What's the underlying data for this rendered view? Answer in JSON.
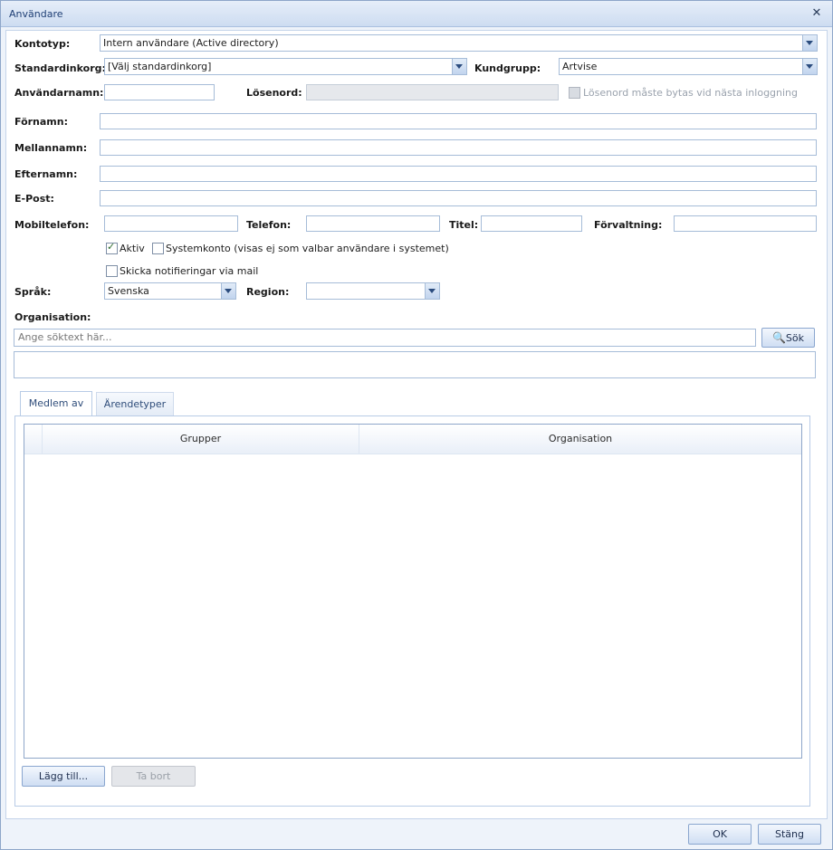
{
  "window": {
    "title": "Användare"
  },
  "form": {
    "kontotyp": {
      "label": "Kontotyp:",
      "value": "Intern användare (Active directory)"
    },
    "standardinkorg": {
      "label": "Standardinkorg:",
      "value": "[Välj standardinkorg]"
    },
    "kundgrupp": {
      "label": "Kundgrupp:",
      "value": "Artvise"
    },
    "anvandarnamn": {
      "label": "Användarnamn:",
      "value": ""
    },
    "losenord": {
      "label": "Lösenord:",
      "value": ""
    },
    "losenord_change": {
      "label": "Lösenord måste bytas vid nästa inloggning",
      "checked": false
    },
    "fornamn": {
      "label": "Förnamn:",
      "value": ""
    },
    "mellannamn": {
      "label": "Mellannamn:",
      "value": ""
    },
    "efternamn": {
      "label": "Efternamn:",
      "value": ""
    },
    "epost": {
      "label": "E-Post:",
      "value": ""
    },
    "mobiltelefon": {
      "label": "Mobiltelefon:",
      "value": ""
    },
    "telefon": {
      "label": "Telefon:",
      "value": ""
    },
    "titel": {
      "label": "Titel:",
      "value": ""
    },
    "forvaltning": {
      "label": "Förvaltning:",
      "value": ""
    },
    "aktiv": {
      "label": "Aktiv",
      "checked": true
    },
    "systemkonto": {
      "label": "Systemkonto (visas ej som valbar användare i systemet)",
      "checked": false
    },
    "notifieringar": {
      "label": "Skicka notifieringar via mail",
      "checked": false
    },
    "sprak": {
      "label": "Språk:",
      "value": "Svenska"
    },
    "region": {
      "label": "Region:",
      "value": ""
    },
    "organisation": {
      "label": "Organisation:",
      "search_placeholder": "Ange söktext här...",
      "search_button": "Sök"
    }
  },
  "tabs": [
    {
      "label": "Medlem av",
      "active": true
    },
    {
      "label": "Ärendetyper",
      "active": false
    }
  ],
  "grid": {
    "columns": [
      "Grupper",
      "Organisation"
    ],
    "rows": []
  },
  "panel_buttons": {
    "add": "Lägg till...",
    "remove": "Ta bort"
  },
  "footer": {
    "ok": "OK",
    "close": "Stäng"
  }
}
